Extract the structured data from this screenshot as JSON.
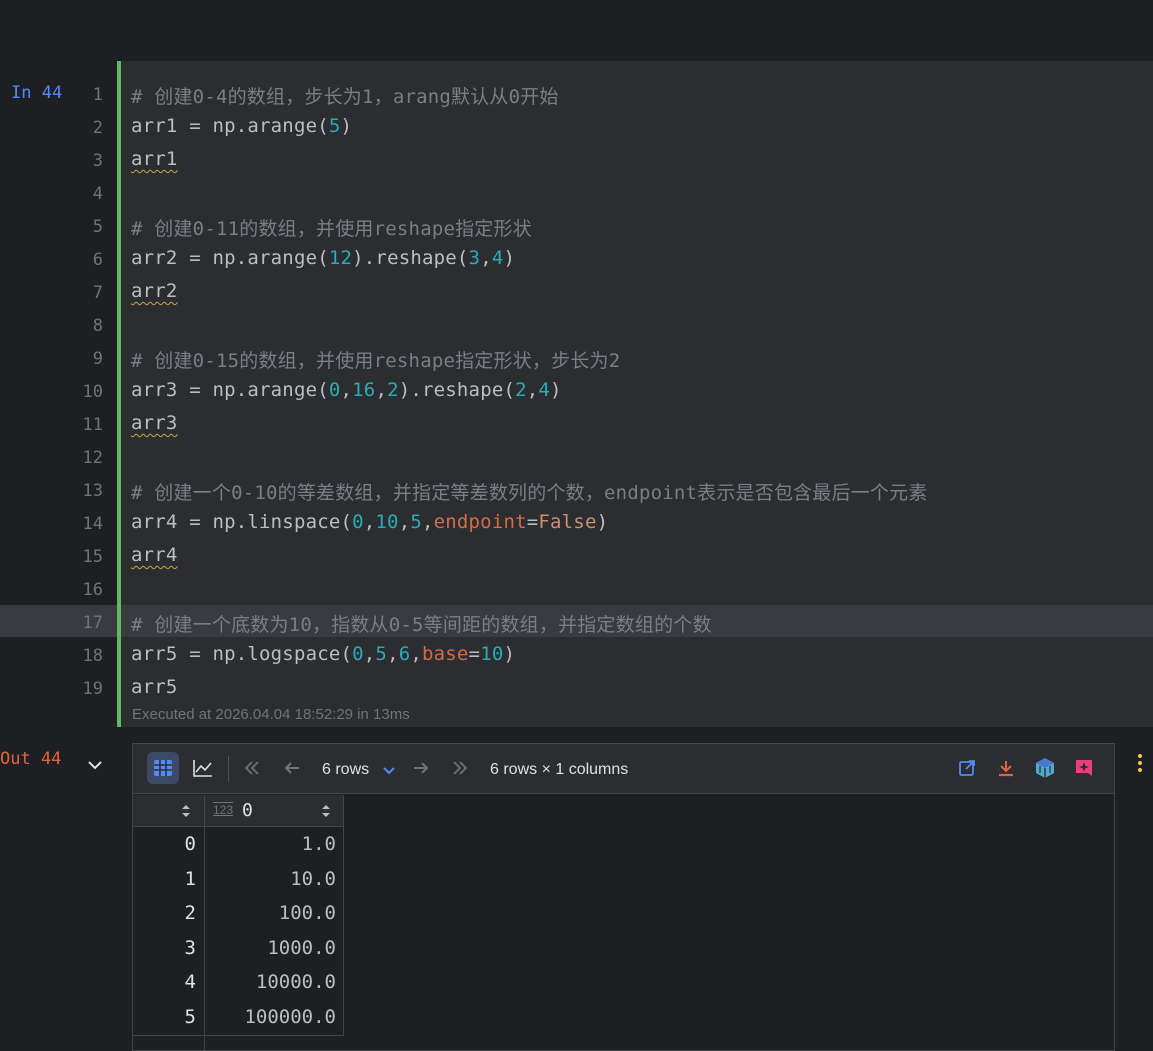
{
  "cell": {
    "in_label": "In 44",
    "out_label": "Out 44",
    "line_numbers": [
      "1",
      "2",
      "3",
      "4",
      "5",
      "6",
      "7",
      "8",
      "9",
      "10",
      "11",
      "12",
      "13",
      "14",
      "15",
      "16",
      "17",
      "18",
      "19"
    ],
    "code": {
      "l1": "# 创建0-4的数组，步长为1，arang默认从0开始",
      "l2_a": "arr1 = np.arange(",
      "l2_n": "5",
      "l2_b": ")",
      "l3": "arr1",
      "l5": "# 创建0-11的数组，并使用reshape指定形状",
      "l6_a": "arr2 = np.arange(",
      "l6_n1": "12",
      "l6_b": ").reshape(",
      "l6_n2": "3",
      "l6_c": ",",
      "l6_n3": "4",
      "l6_d": ")",
      "l7": "arr2",
      "l9": "# 创建0-15的数组，并使用reshape指定形状，步长为2",
      "l10_a": "arr3 = np.arange(",
      "l10_n1": "0",
      "l10_s1": ",",
      "l10_n2": "16",
      "l10_s2": ",",
      "l10_n3": "2",
      "l10_b": ").reshape(",
      "l10_n4": "2",
      "l10_s3": ",",
      "l10_n5": "4",
      "l10_c": ")",
      "l11": "arr3",
      "l13": "# 创建一个0-10的等差数组，并指定等差数列的个数，endpoint表示是否包含最后一个元素",
      "l14_a": "arr4 = np.linspace(",
      "l14_n1": "0",
      "l14_s1": ",",
      "l14_n2": "10",
      "l14_s2": ",",
      "l14_n3": "5",
      "l14_s3": ",",
      "l14_kw": "endpoint",
      "l14_eq": "=",
      "l14_false": "False",
      "l14_b": ")",
      "l15": "arr4",
      "l17": "# 创建一个底数为10，指数从0-5等间距的数组，并指定数组的个数",
      "l18_a": "arr5 = np.logspace(",
      "l18_n1": "0",
      "l18_s1": ",",
      "l18_n2": "5",
      "l18_s2": ",",
      "l18_n3": "6",
      "l18_s3": ",",
      "l18_kw": "base",
      "l18_eq": "=",
      "l18_n4": "10",
      "l18_b": ")",
      "l19": "arr5"
    },
    "executed_info": "Executed at 2026.04.04 18:52:29 in 13ms"
  },
  "output": {
    "toolbar": {
      "rows_selector": "6 rows",
      "shape_info": "6 rows × 1 columns"
    },
    "table": {
      "column_type_icon": "123",
      "column_header": "0",
      "index": [
        "0",
        "1",
        "2",
        "3",
        "4",
        "5"
      ],
      "values": [
        "1.0",
        "10.0",
        "100.0",
        "1000.0",
        "10000.0",
        "100000.0"
      ]
    }
  },
  "icons": [
    "table-view-icon",
    "chart-view-icon",
    "first-page-icon",
    "previous-page-icon",
    "next-page-icon",
    "last-page-icon",
    "open-in-editor-icon",
    "download-icon",
    "numpy-icon",
    "ai-assistant-icon",
    "kebab-menu-icon",
    "collapse-chevron-icon",
    "sort-icon"
  ],
  "colors": {
    "accent": "#548af7",
    "executed_bar": "#5fb865",
    "out_label": "#e4633e",
    "number": "#2aacb8",
    "kwarg": "#d56b47"
  }
}
